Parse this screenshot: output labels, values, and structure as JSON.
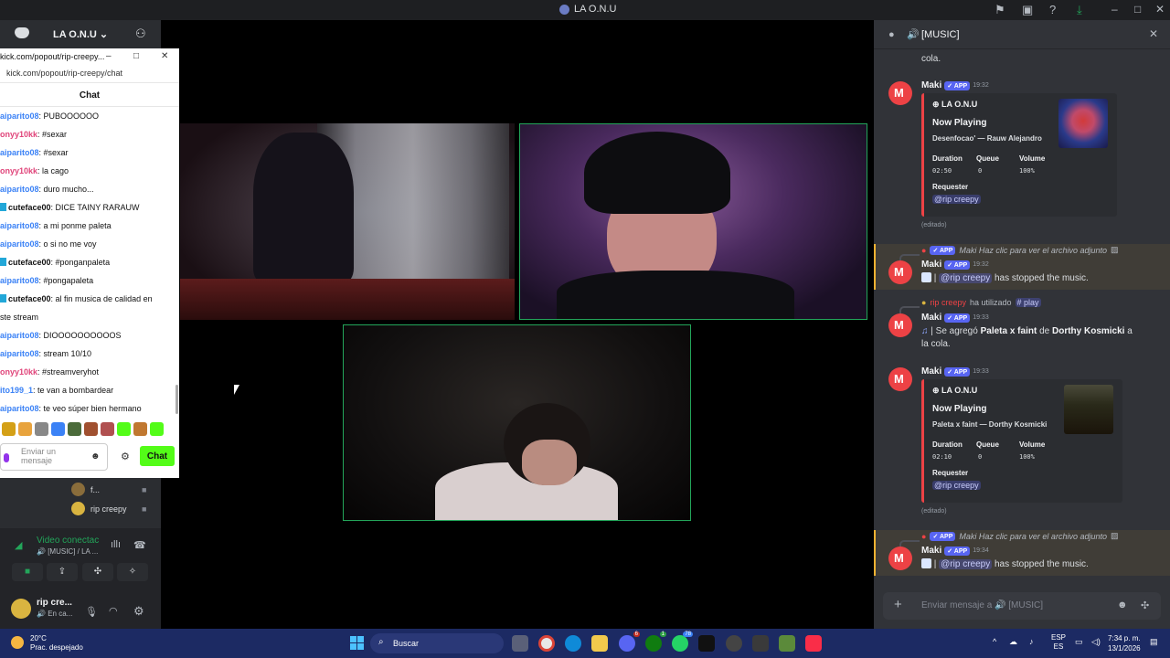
{
  "window": {
    "title": "LA O.N.U"
  },
  "server": {
    "name": "LA O.N.U"
  },
  "popout": {
    "title": "kick.com/popout/rip-creepy...",
    "url": "kick.com/popout/rip-creepy/chat",
    "header": "Chat",
    "messages": [
      {
        "user": "aiparito08",
        "text": ": PUBOOOOOO",
        "color": "blue"
      },
      {
        "user": "onyy10kk",
        "text": ": #sexar",
        "color": "pink"
      },
      {
        "user": "aiparito08",
        "text": ": #sexar",
        "color": "blue"
      },
      {
        "user": "onyy10kk",
        "text": ": la cago",
        "color": "pink"
      },
      {
        "user": "aiparito08",
        "text": ": duro mucho...",
        "color": "blue"
      },
      {
        "user": "cuteface00",
        "text": ": DICE TAINY RARAUW",
        "color": "teal"
      },
      {
        "user": "aiparito08",
        "text": ": a mi ponme paleta",
        "color": "blue"
      },
      {
        "user": "aiparito08",
        "text": ": o si no me voy",
        "color": "blue"
      },
      {
        "user": "cuteface00",
        "text": ": #ponganpaleta",
        "color": "teal"
      },
      {
        "user": "aiparito08",
        "text": ": #pongapaleta",
        "color": "blue"
      },
      {
        "user": "cuteface00",
        "text": ": al fin musica de calidad en",
        "color": "teal"
      },
      {
        "user": "",
        "text": "ste stream",
        "color": "none"
      },
      {
        "user": "aiparito08",
        "text": ": DIOOOOOOOOOOS",
        "color": "blue"
      },
      {
        "user": "aiparito08",
        "text": ": stream 10/10",
        "color": "blue"
      },
      {
        "user": "onyy10kk",
        "text": ": #streamveryhot",
        "color": "pink"
      },
      {
        "user": "ito199_1",
        "text": ": te van a bombardear",
        "color": "blue"
      },
      {
        "user": "aiparito08",
        "text": ": te veo súper bien hermano",
        "color": "blue"
      }
    ],
    "input_placeholder_1": "Enviar un",
    "input_placeholder_2": "mensaje",
    "chat_button": "Chat"
  },
  "voice_users": [
    {
      "name": "f..."
    },
    {
      "name": "rip creepy"
    }
  ],
  "voice": {
    "status": "Video conectac",
    "channel": "[MUSIC] / LA ...",
    "user_name": "rip cre...",
    "user_sub": "En ca..."
  },
  "right": {
    "channel": "[MUSIC]",
    "top_fragment": "cola.",
    "bot_name": "Maki",
    "app_tag": "APP",
    "messages": [
      {
        "time": "19:32",
        "embed": {
          "author": "LA O.N.U",
          "title": "Now Playing",
          "desc": "Desenfocao' — Rauw Alejandro",
          "duration_label": "Duration",
          "duration": "02:50",
          "queue_label": "Queue",
          "queue": "0",
          "volume_label": "Volume",
          "volume": "100%",
          "requester_label": "Requester",
          "requester": "@rip creepy"
        },
        "edited": "(editado)"
      },
      {
        "reply_text": "Maki Haz clic para ver el archivo adjunto",
        "time": "19:32",
        "body_mention": "@rip creepy",
        "body_text": "has stopped the music."
      },
      {
        "reply_user": "rip creepy",
        "reply_used": "ha utilizado",
        "reply_cmd": "play",
        "time": "19:33",
        "body_pre": "| Se agregó",
        "song": "Paleta x faint",
        "body_de": "de",
        "artist": "Dorthy Kosmicki",
        "body_post": "a",
        "body_line2": "la cola."
      },
      {
        "time": "19:33",
        "embed": {
          "author": "LA O.N.U",
          "title": "Now Playing",
          "desc": "Paleta x faint — Dorthy Kosmicki",
          "duration_label": "Duration",
          "duration": "02:10",
          "queue_label": "Queue",
          "queue": "0",
          "volume_label": "Volume",
          "volume": "100%",
          "requester_label": "Requester",
          "requester": "@rip creepy"
        },
        "edited": "(editado)"
      },
      {
        "reply_text": "Maki Haz clic para ver el archivo adjunto",
        "time": "19:34",
        "body_mention": "@rip creepy",
        "body_text": "has stopped the music."
      }
    ],
    "composer_placeholder": "Enviar mensaje a 🔊 [MUSIC]"
  },
  "taskbar": {
    "temp": "20°C",
    "weather": "Prac. despejado",
    "search": "Buscar",
    "lang1": "ESP",
    "lang2": "ES",
    "time": "7:34 p. m.",
    "date": "13/1/2026",
    "badges": {
      "discord": "6",
      "xbox": "1",
      "whatsapp": "78"
    }
  }
}
